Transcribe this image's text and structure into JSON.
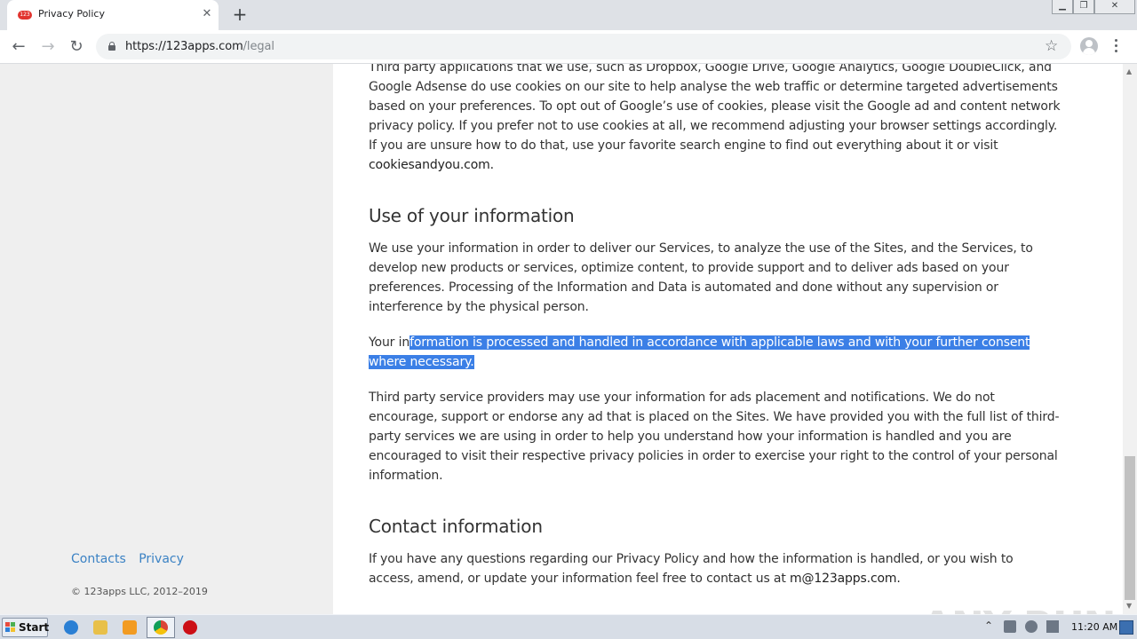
{
  "browser": {
    "tab_title": "Privacy Policy",
    "tab_favicon_text": "123",
    "url_host": "https://123apps.com",
    "url_path": "/legal"
  },
  "sidebar": {
    "links": [
      "Contacts",
      "Privacy"
    ],
    "copyright": "© 123apps LLC, 2012–2019"
  },
  "content": {
    "p_cookies": "Third party applications that we use, such as Dropbox, Google Drive, Google Analytics, Google DoubleClick, and Google Adsense do use cookies on our site to help analyse the web traffic or determine targeted advertisements based on your preferences. To opt out of Google’s use of cookies, please visit the Google ad and content network privacy policy. If you prefer not to use cookies at all, we recommend adjusting your browser settings accordingly. If you are unsure how to do that, use your favorite search engine to find out everything about it or visit",
    "p_cookies_link": "cookiesandyou.com.",
    "h_use": "Use of your information",
    "p_use": "We use your information in order to deliver our Services, to analyze the use of the Sites, and the Services, to develop new products or services, optimize content, to provide support and to deliver ads based on your preferences. Processing of the Information and Data is automated and done without any supervision or interference by the physical person.",
    "p_processed_start": "Your in",
    "p_processed_selected": "formation is processed and handled in accordance with applicable laws and with your further consent where necessary.",
    "p_third": "Third party service providers may use your information for ads placement and notifications. We do not encourage, support or endorse any ad that is placed on the Sites. We have provided you with the full list of third-party services we are using in order to help you understand how your information is handled and you are encouraged to visit their respective privacy policies in order to exercise your right to the control of your personal information.",
    "h_contact": "Contact information",
    "p_contact": "If you have any questions regarding our Privacy Policy and how the information is handled, or you wish to access, amend, or update your information feel free to contact us at",
    "p_contact_email": "m@123apps.com."
  },
  "watermark": "ANY RUN",
  "taskbar": {
    "start_label": "Start",
    "clock": "11:20 AM"
  },
  "colors": {
    "selection": "#3b7fe6",
    "link": "#3b82c4",
    "sidebar_bg": "#efefef"
  }
}
